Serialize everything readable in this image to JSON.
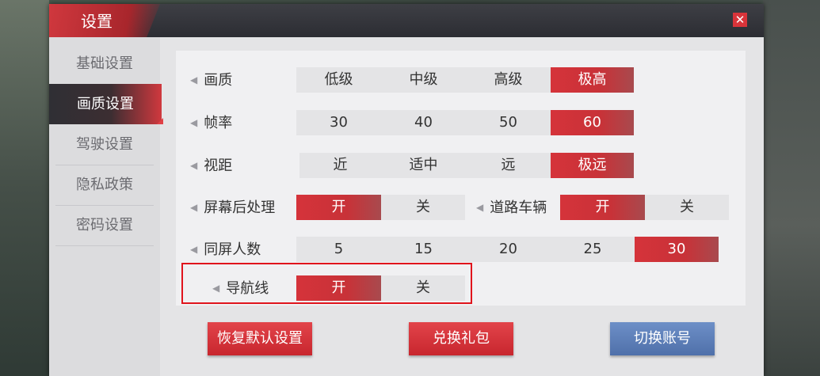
{
  "window": {
    "title": "设置",
    "close_label": "✕"
  },
  "sidebar": {
    "items": [
      {
        "label": "基础设置",
        "active": false
      },
      {
        "label": "画质设置",
        "active": true
      },
      {
        "label": "驾驶设置",
        "active": false
      },
      {
        "label": "隐私政策",
        "active": false
      },
      {
        "label": "密码设置",
        "active": false
      }
    ]
  },
  "settings": {
    "quality": {
      "label": "画质",
      "options": [
        "低级",
        "中级",
        "高级",
        "极高"
      ],
      "selected": "极高"
    },
    "framerate": {
      "label": "帧率",
      "options": [
        "30",
        "40",
        "50",
        "60"
      ],
      "selected": "60"
    },
    "view_distance": {
      "label": "视距",
      "options": [
        "近",
        "适中",
        "远",
        "极远"
      ],
      "selected": "极远"
    },
    "post_processing": {
      "label": "屏幕后处理",
      "options": [
        "开",
        "关"
      ],
      "selected": "开"
    },
    "road_vehicles": {
      "label": "道路车辆",
      "options": [
        "开",
        "关"
      ],
      "selected": "开"
    },
    "same_screen_players": {
      "label": "同屏人数",
      "options": [
        "5",
        "15",
        "20",
        "25",
        "30"
      ],
      "selected": "30"
    },
    "nav_line": {
      "label": "导航线",
      "options": [
        "开",
        "关"
      ],
      "selected": "开"
    }
  },
  "buttons": {
    "reset": "恢复默认设置",
    "redeem": "兑换礼包",
    "switch_account": "切换账号"
  },
  "colors": {
    "accent_red": "#d5333a",
    "accent_blue": "#5a7bb6",
    "highlight_border": "#e0141c"
  }
}
